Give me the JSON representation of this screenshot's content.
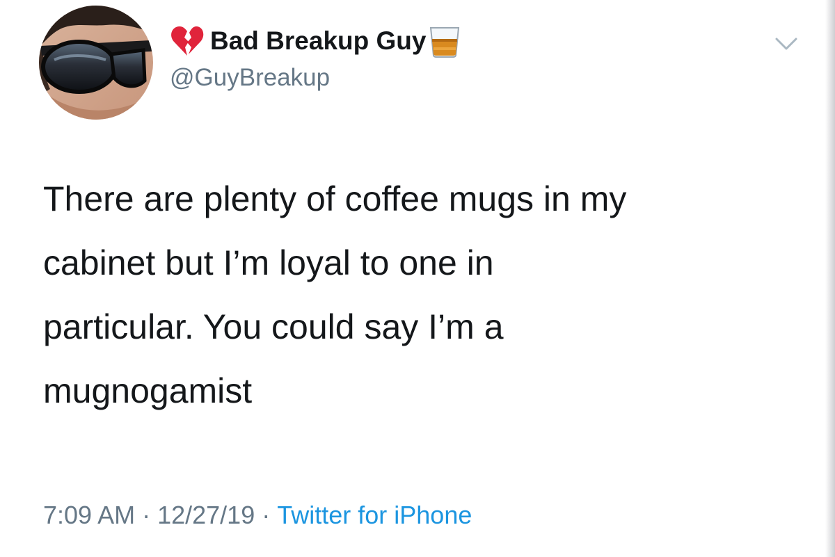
{
  "author": {
    "display_name": "Bad Breakup Guy",
    "handle": "@GuyBreakup",
    "leading_emoji": "broken-heart-icon",
    "trailing_emoji": "whiskey-glass-icon"
  },
  "tweet": {
    "text_lines": [
      "There are plenty of coffee mugs in my",
      "cabinet but I’m loyal to one in",
      "particular. You could say I’m a",
      "mugnogamist"
    ]
  },
  "meta": {
    "time": "7:09 AM",
    "date": "12/27/19",
    "separator": "·",
    "source": "Twitter for iPhone"
  },
  "colors": {
    "text": "#14171a",
    "secondary": "#657786",
    "link": "#1b95e0"
  }
}
